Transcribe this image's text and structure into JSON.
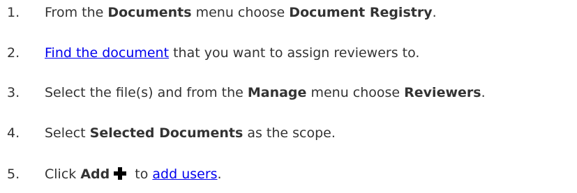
{
  "steps": [
    {
      "number": "1.",
      "parts": {
        "a": "From the ",
        "b_menu": "Documents",
        "c": " menu choose ",
        "d_item": "Document Registry",
        "e": "."
      }
    },
    {
      "number": "2.",
      "parts": {
        "link": "Find the document",
        "rest": " that you want to assign reviewers to."
      }
    },
    {
      "number": "3.",
      "parts": {
        "a": "Select the file(s) and from the ",
        "b_menu": "Manage",
        "c": " menu choose ",
        "d_item": "Reviewers",
        "e": "."
      }
    },
    {
      "number": "4.",
      "parts": {
        "a": "Select ",
        "b_scope": "Selected Documents",
        "c": " as the scope."
      }
    },
    {
      "number": "5.",
      "parts": {
        "a": "Click ",
        "b_add": "Add",
        "c": " to ",
        "link": "add users",
        "d": "."
      }
    }
  ],
  "icons": {
    "add": "plus-icon"
  },
  "colors": {
    "text": "#333333",
    "link": "#0000ee",
    "icon": "#000000"
  }
}
